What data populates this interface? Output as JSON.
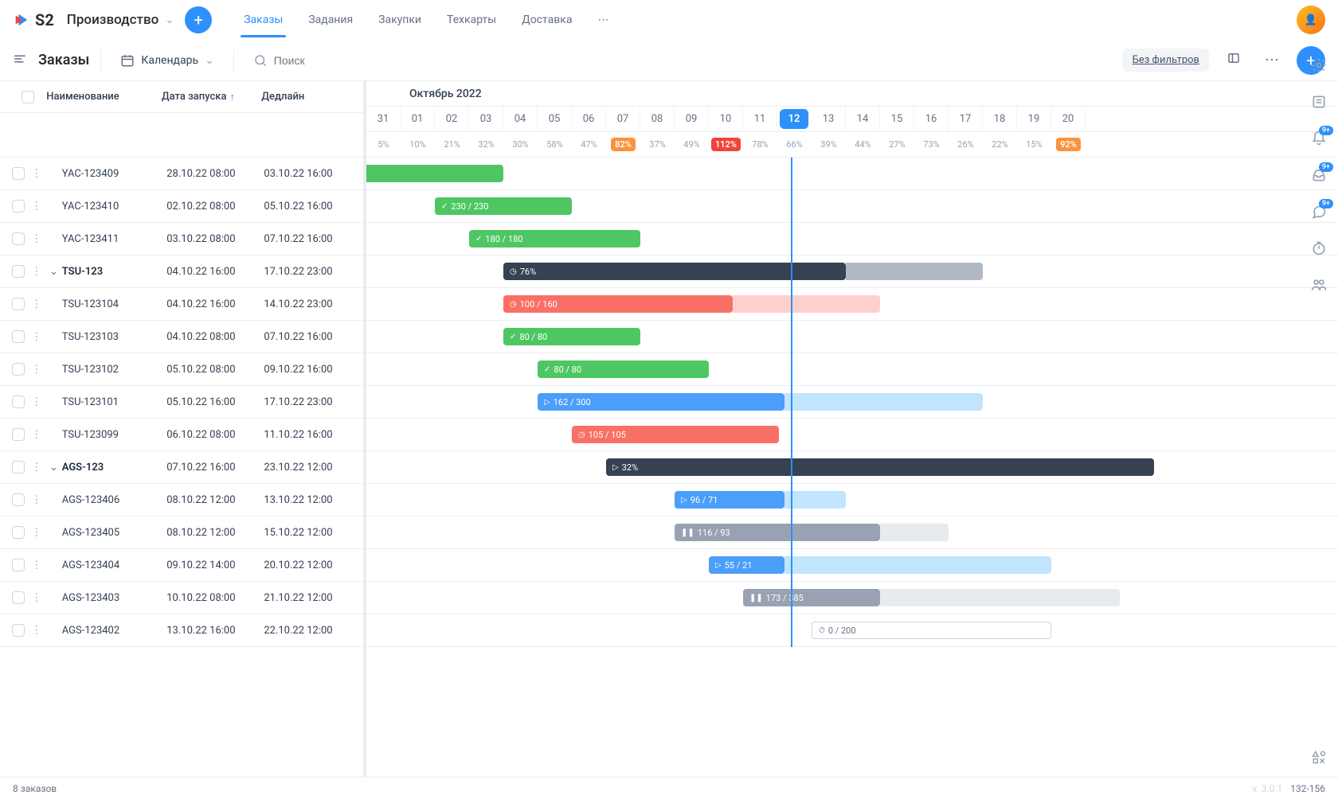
{
  "app": {
    "logo_text": "S2",
    "module": "Производство",
    "tabs": [
      "Заказы",
      "Задания",
      "Закупки",
      "Техкарты",
      "Доставка"
    ],
    "more": "⋯"
  },
  "subbar": {
    "title": "Заказы",
    "view": "Календарь",
    "search_placeholder": "Поиск",
    "nofilter": "Без фильтров"
  },
  "headers": {
    "name": "Наименование",
    "start": "Дата запуска",
    "deadline": "Дедлайн"
  },
  "month_label": "Октябрь 2022",
  "days": [
    "31",
    "01",
    "02",
    "03",
    "04",
    "05",
    "06",
    "07",
    "08",
    "09",
    "10",
    "11",
    "12",
    "13",
    "14",
    "15",
    "16",
    "17",
    "18",
    "19",
    "20"
  ],
  "today_index": 12,
  "pcts": [
    {
      "v": "5%",
      "t": "n"
    },
    {
      "v": "10%",
      "t": "n"
    },
    {
      "v": "21%",
      "t": "n"
    },
    {
      "v": "32%",
      "t": "n"
    },
    {
      "v": "30%",
      "t": "n"
    },
    {
      "v": "58%",
      "t": "n"
    },
    {
      "v": "47%",
      "t": "n"
    },
    {
      "v": "82%",
      "t": "o"
    },
    {
      "v": "37%",
      "t": "n"
    },
    {
      "v": "49%",
      "t": "n"
    },
    {
      "v": "112%",
      "t": "r"
    },
    {
      "v": "78%",
      "t": "n"
    },
    {
      "v": "66%",
      "t": "n"
    },
    {
      "v": "39%",
      "t": "n"
    },
    {
      "v": "44%",
      "t": "n"
    },
    {
      "v": "27%",
      "t": "n"
    },
    {
      "v": "73%",
      "t": "n"
    },
    {
      "v": "26%",
      "t": "n"
    },
    {
      "v": "22%",
      "t": "n"
    },
    {
      "v": "15%",
      "t": "n"
    },
    {
      "v": "92%",
      "t": "o"
    }
  ],
  "rows": [
    {
      "name": "YAC-123409",
      "start": "28.10.22 08:00",
      "deadline": "03.10.22 16:00",
      "group": false,
      "bar": {
        "from": -0.2,
        "to": 4,
        "color": "green",
        "label": ""
      }
    },
    {
      "name": "YAC-123410",
      "start": "02.10.22 08:00",
      "deadline": "05.10.22 16:00",
      "group": false,
      "bar": {
        "from": 2,
        "to": 6,
        "color": "green",
        "label": "230 / 230",
        "icon": "check"
      }
    },
    {
      "name": "YAC-123411",
      "start": "03.10.22 08:00",
      "deadline": "07.10.22 16:00",
      "group": false,
      "bar": {
        "from": 3,
        "to": 8,
        "color": "green",
        "label": "180 / 180",
        "icon": "check"
      }
    },
    {
      "name": "TSU-123",
      "start": "04.10.22 16:00",
      "deadline": "17.10.22 23:00",
      "group": true,
      "bar": {
        "from": 4,
        "to": 14,
        "color": "darknavy",
        "label": "76%",
        "icon": "clock",
        "light_to": 18
      }
    },
    {
      "name": "TSU-123104",
      "start": "04.10.22 16:00",
      "deadline": "14.10.22 23:00",
      "group": false,
      "bar": {
        "from": 4,
        "to": 10.7,
        "color": "red",
        "label": "100 / 160",
        "icon": "clock",
        "light_to": 15
      }
    },
    {
      "name": "TSU-123103",
      "start": "04.10.22 08:00",
      "deadline": "07.10.22 16:00",
      "group": false,
      "bar": {
        "from": 4,
        "to": 8,
        "color": "green",
        "label": "80 / 80",
        "icon": "check"
      }
    },
    {
      "name": "TSU-123102",
      "start": "05.10.22 08:00",
      "deadline": "09.10.22 16:00",
      "group": false,
      "bar": {
        "from": 5,
        "to": 10,
        "color": "green",
        "label": "80 / 80",
        "icon": "check"
      }
    },
    {
      "name": "TSU-123101",
      "start": "05.10.22 16:00",
      "deadline": "17.10.22 23:00",
      "group": false,
      "bar": {
        "from": 5,
        "to": 12.2,
        "color": "blue",
        "label": "162 / 300",
        "icon": "play",
        "light_to": 18
      }
    },
    {
      "name": "TSU-123099",
      "start": "06.10.22 08:00",
      "deadline": "11.10.22 16:00",
      "group": false,
      "bar": {
        "from": 6,
        "to": 12.05,
        "color": "red",
        "label": "105 / 105",
        "icon": "clock"
      }
    },
    {
      "name": "AGS-123",
      "start": "07.10.22 16:00",
      "deadline": "23.10.22 12:00",
      "group": true,
      "bar": {
        "from": 7,
        "to": 23,
        "color": "darknavy",
        "label": "32%",
        "icon": "play"
      }
    },
    {
      "name": "AGS-123406",
      "start": "08.10.22 12:00",
      "deadline": "13.10.22 12:00",
      "group": false,
      "bar": {
        "from": 9,
        "to": 12.2,
        "color": "blue",
        "label": "96 / 71",
        "icon": "play",
        "light_to": 14
      }
    },
    {
      "name": "AGS-123405",
      "start": "08.10.22 12:00",
      "deadline": "15.10.22 12:00",
      "group": false,
      "bar": {
        "from": 9,
        "to": 15,
        "color": "grey",
        "label": "116 / 93",
        "icon": "pause",
        "light_to": 17
      }
    },
    {
      "name": "AGS-123404",
      "start": "09.10.22 14:00",
      "deadline": "20.10.22 12:00",
      "group": false,
      "bar": {
        "from": 10,
        "to": 12.2,
        "color": "blue",
        "label": "55 / 21",
        "icon": "play",
        "light_to": 20
      }
    },
    {
      "name": "AGS-123403",
      "start": "10.10.22 08:00",
      "deadline": "21.10.22 12:00",
      "group": false,
      "bar": {
        "from": 11,
        "to": 15,
        "color": "grey",
        "label": "173 / 385",
        "icon": "pause",
        "light_to": 22
      }
    },
    {
      "name": "AGS-123402",
      "start": "13.10.22 16:00",
      "deadline": "22.10.22 12:00",
      "group": false,
      "bar": {
        "from": 13,
        "to": 20,
        "color": "white",
        "label": "0 / 200",
        "icon": "timer"
      }
    }
  ],
  "footer": {
    "count": "8 заказов",
    "version": "v. 3.0.1",
    "range": "132-156"
  },
  "icons": {
    "check": "✓",
    "clock": "◷",
    "play": "▷",
    "pause": "❚❚",
    "timer": "⏱"
  },
  "badge": "9+"
}
